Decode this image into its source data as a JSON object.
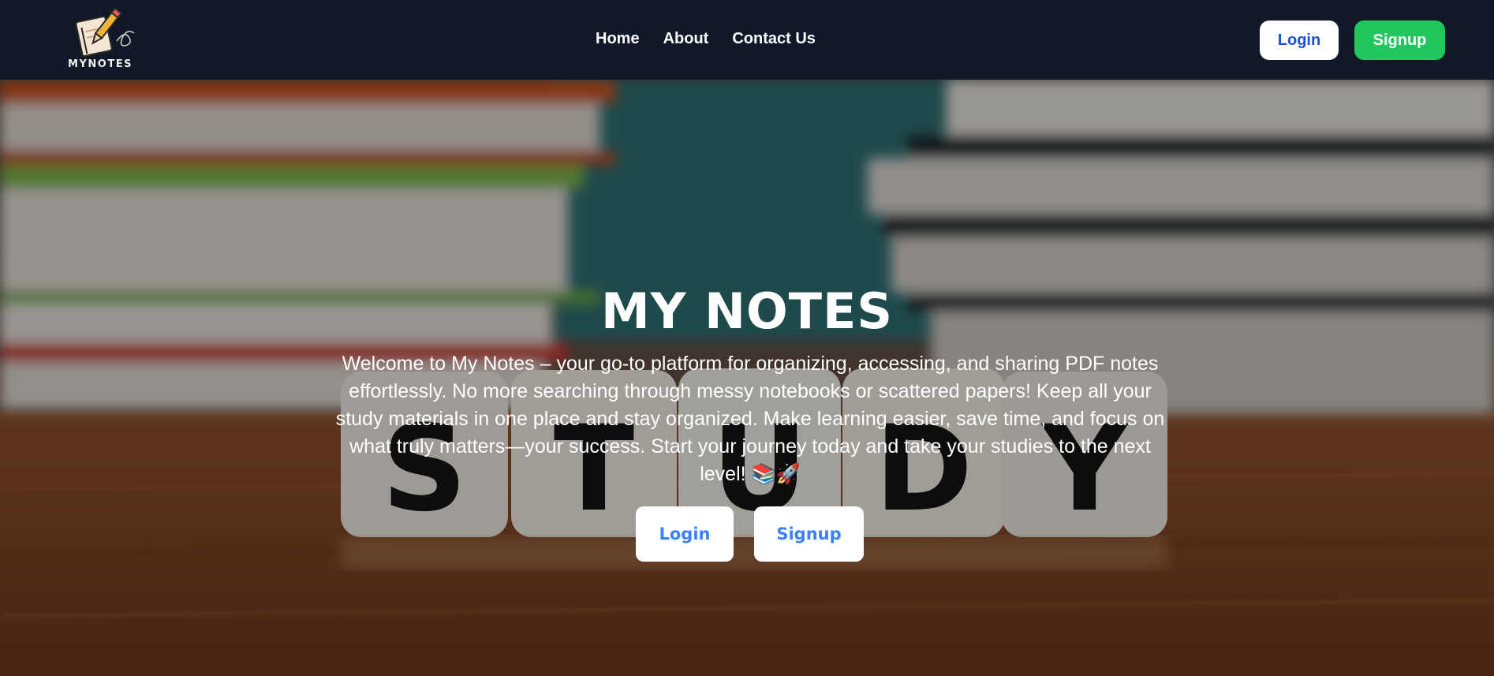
{
  "brand": {
    "logo_text": "MYNOTES",
    "icon": "notebook-pencil-icon"
  },
  "nav": {
    "links": [
      "Home",
      "About",
      "Contact Us"
    ],
    "login_label": "Login",
    "signup_label": "Signup"
  },
  "hero": {
    "title": "MY NOTES",
    "description": "Welcome to My Notes – your go-to platform for organizing, accessing, and sharing PDF notes effortlessly. No more searching through messy notebooks or scattered papers! Keep all your study materials in one place and stay organized. Make learning easier, save time, and focus on what truly matters—your success. Start your journey today and take your studies to the next level! 📚🚀",
    "login_label": "Login",
    "signup_label": "Signup",
    "background": "books-and-study-dice-photo",
    "dice_letters": [
      "S",
      "T",
      "U",
      "D",
      "Y"
    ]
  },
  "colors": {
    "navbar": "#111827",
    "signup_green": "#22c55e",
    "login_blue": "#1d4ed8",
    "hero_button_text": "#3b82f6"
  }
}
